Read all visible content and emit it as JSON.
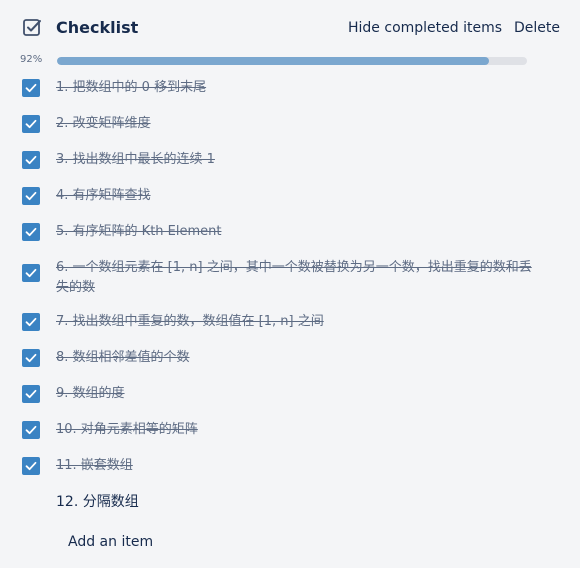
{
  "header": {
    "title": "Checklist",
    "hide_label": "Hide completed items",
    "delete_label": "Delete",
    "icon": "checklist-icon"
  },
  "progress": {
    "percent_label": "92%",
    "fraction": 0.92
  },
  "items": [
    {
      "text": "1. 把数组中的 0 移到末尾",
      "checked": true
    },
    {
      "text": "2. 改变矩阵维度",
      "checked": true
    },
    {
      "text": "3. 找出数组中最长的连续 1",
      "checked": true
    },
    {
      "text": "4. 有序矩阵查找",
      "checked": true
    },
    {
      "text": "5. 有序矩阵的 Kth Element",
      "checked": true
    },
    {
      "text": "6. 一个数组元素在 [1, n] 之间，其中一个数被替换为另一个数，找出重复的数和丢失的数",
      "checked": true
    },
    {
      "text": "7. 找出数组中重复的数，数组值在 [1, n] 之间",
      "checked": true
    },
    {
      "text": "8. 数组相邻差值的个数",
      "checked": true
    },
    {
      "text": "9. 数组的度",
      "checked": true
    },
    {
      "text": "10. 对角元素相等的矩阵",
      "checked": true
    },
    {
      "text": "11. 嵌套数组",
      "checked": true
    },
    {
      "text": "12. 分隔数组",
      "checked": false
    }
  ],
  "add_item_label": "Add an item",
  "colors": {
    "accent": "#3a83c3",
    "progress": "#7ba7cf",
    "text": "#172b4d",
    "muted": "#5e6c84"
  }
}
